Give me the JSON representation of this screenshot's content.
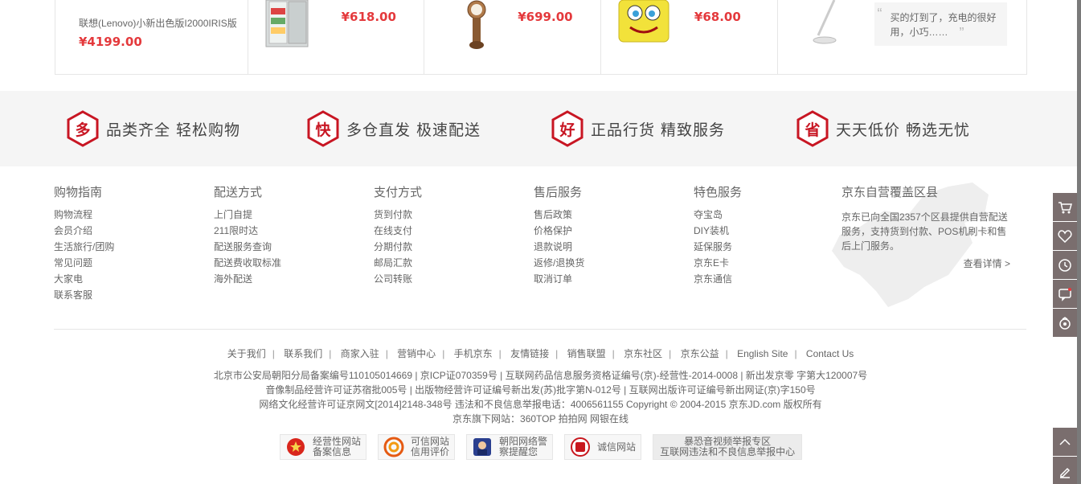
{
  "products": [
    {
      "name": "联想(Lenovo)小新出色版I2000IRIS版",
      "price": "¥4199.00"
    },
    {
      "name": "",
      "price": "¥618.00"
    },
    {
      "name": "",
      "price": "¥699.00"
    },
    {
      "name": "",
      "price": "¥68.00"
    }
  ],
  "review": {
    "text": "买的灯到了，充电的很好用，小巧……"
  },
  "promises": [
    {
      "icon_char": "多",
      "text": "品类齐全  轻松购物"
    },
    {
      "icon_char": "快",
      "text": "多仓直发  极速配送"
    },
    {
      "icon_char": "好",
      "text": "正品行货  精致服务"
    },
    {
      "icon_char": "省",
      "text": "天天低价  畅选无忧"
    }
  ],
  "guides": [
    {
      "title": "购物指南",
      "items": [
        "购物流程",
        "会员介绍",
        "生活旅行/团购",
        "常见问题",
        "大家电",
        "联系客服"
      ]
    },
    {
      "title": "配送方式",
      "items": [
        "上门自提",
        "211限时达",
        "配送服务查询",
        "配送费收取标准",
        "海外配送"
      ]
    },
    {
      "title": "支付方式",
      "items": [
        "货到付款",
        "在线支付",
        "分期付款",
        "邮局汇款",
        "公司转账"
      ]
    },
    {
      "title": "售后服务",
      "items": [
        "售后政策",
        "价格保护",
        "退款说明",
        "返修/退换货",
        "取消订单"
      ]
    },
    {
      "title": "特色服务",
      "items": [
        "夺宝岛",
        "DIY装机",
        "延保服务",
        "京东E卡",
        "京东通信"
      ]
    }
  ],
  "coverage": {
    "title": "京东自营覆盖区县",
    "text": "京东已向全国2357个区县提供自营配送服务，支持货到付款、POS机刷卡和售后上门服务。",
    "more": "查看详情 >"
  },
  "footer_links": [
    "关于我们",
    "联系我们",
    "商家入驻",
    "营销中心",
    "手机京东",
    "友情链接",
    "销售联盟",
    "京东社区",
    "京东公益",
    "English Site",
    "Contact Us"
  ],
  "copyright": [
    "北京市公安局朝阳分局备案编号110105014669  |  京ICP证070359号  |  互联网药品信息服务资格证编号(京)-经营性-2014-0008  |  新出发京零 字第大120007号",
    "音像制品经营许可证苏宿批005号  |  出版物经营许可证编号新出发(苏)批字第N-012号  |  互联网出版许可证编号新出网证(京)字150号",
    "网络文化经营许可证京网文[2014]2148-348号  违法和不良信息举报电话：4006561155  Copyright © 2004-2015  京东JD.com 版权所有",
    "京东旗下网站：360TOP  拍拍网  网银在线"
  ],
  "badges": [
    {
      "line1": "经营性网站",
      "line2": "备案信息",
      "color": "#d9261c"
    },
    {
      "line1": "可信网站",
      "line2": "信用评价",
      "color": "#e55a12"
    },
    {
      "line1": "朝阳网络警",
      "line2": "察提醒您",
      "color": "#2a3f8f"
    },
    {
      "line1": "诚信网站",
      "line2": "",
      "color": "#c8171e"
    },
    {
      "line1": "暴恐音视频举报专区",
      "line2": "互联网违法和不良信息举报中心",
      "color": "#666666"
    }
  ],
  "toolbar": [
    "cart-icon",
    "heart-icon",
    "history-icon",
    "message-icon",
    "service-icon",
    "back-to-top-icon",
    "feedback-icon"
  ]
}
